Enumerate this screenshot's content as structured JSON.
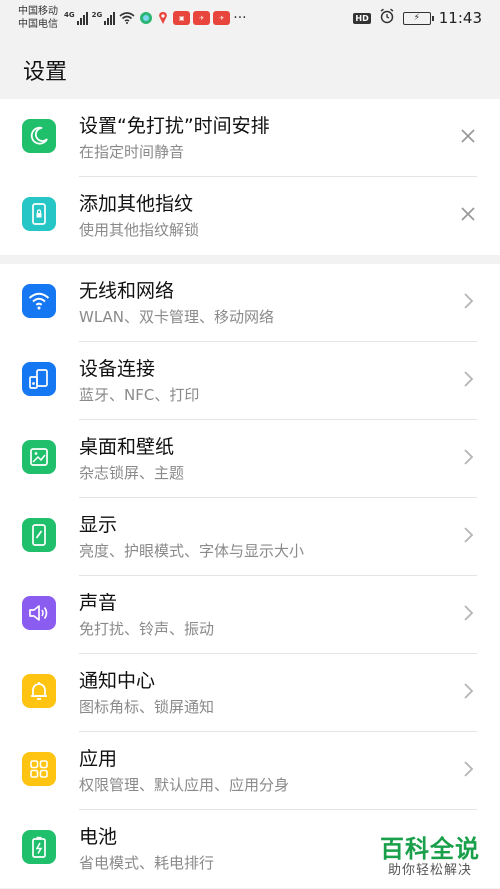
{
  "status_bar": {
    "carrier_1": "中国移动",
    "carrier_2": "中国电信",
    "net_1": "4G",
    "net_2": "2G",
    "more": "···",
    "hd": "HD",
    "time": "11:43",
    "app_badges": [
      "app-red-icon-1",
      "app-red-icon-2",
      "app-red-icon-3"
    ]
  },
  "page": {
    "title": "设置"
  },
  "suggestions": [
    {
      "title": "设置“免打扰”时间安排",
      "subtitle": "在指定时间静音",
      "icon": "moon-icon",
      "color": "#1fbf6b"
    },
    {
      "title": "添加其他指纹",
      "subtitle": "使用其他指纹解锁",
      "icon": "phone-lock-icon",
      "color": "#26c6c6"
    }
  ],
  "settings": [
    {
      "title": "无线和网络",
      "subtitle": "WLAN、双卡管理、移动网络",
      "icon": "wifi-icon",
      "color": "#1677f2"
    },
    {
      "title": "设备连接",
      "subtitle": "蓝牙、NFC、打印",
      "icon": "device-connect-icon",
      "color": "#1677f2"
    },
    {
      "title": "桌面和壁纸",
      "subtitle": "杂志锁屏、主题",
      "icon": "wallpaper-icon",
      "color": "#1fbf6b"
    },
    {
      "title": "显示",
      "subtitle": "亮度、护眼模式、字体与显示大小",
      "icon": "display-icon",
      "color": "#1fbf6b"
    },
    {
      "title": "声音",
      "subtitle": "免打扰、铃声、振动",
      "icon": "speaker-icon",
      "color": "#8a5cf0"
    },
    {
      "title": "通知中心",
      "subtitle": "图标角标、锁屏通知",
      "icon": "bell-icon",
      "color": "#ffc412"
    },
    {
      "title": "应用",
      "subtitle": "权限管理、默认应用、应用分身",
      "icon": "apps-grid-icon",
      "color": "#ffc412"
    },
    {
      "title": "电池",
      "subtitle": "省电模式、耗电排行",
      "icon": "battery-icon",
      "color": "#1fbf6b"
    }
  ],
  "watermark": {
    "main": "百科全说",
    "sub": "助你轻松解决"
  }
}
